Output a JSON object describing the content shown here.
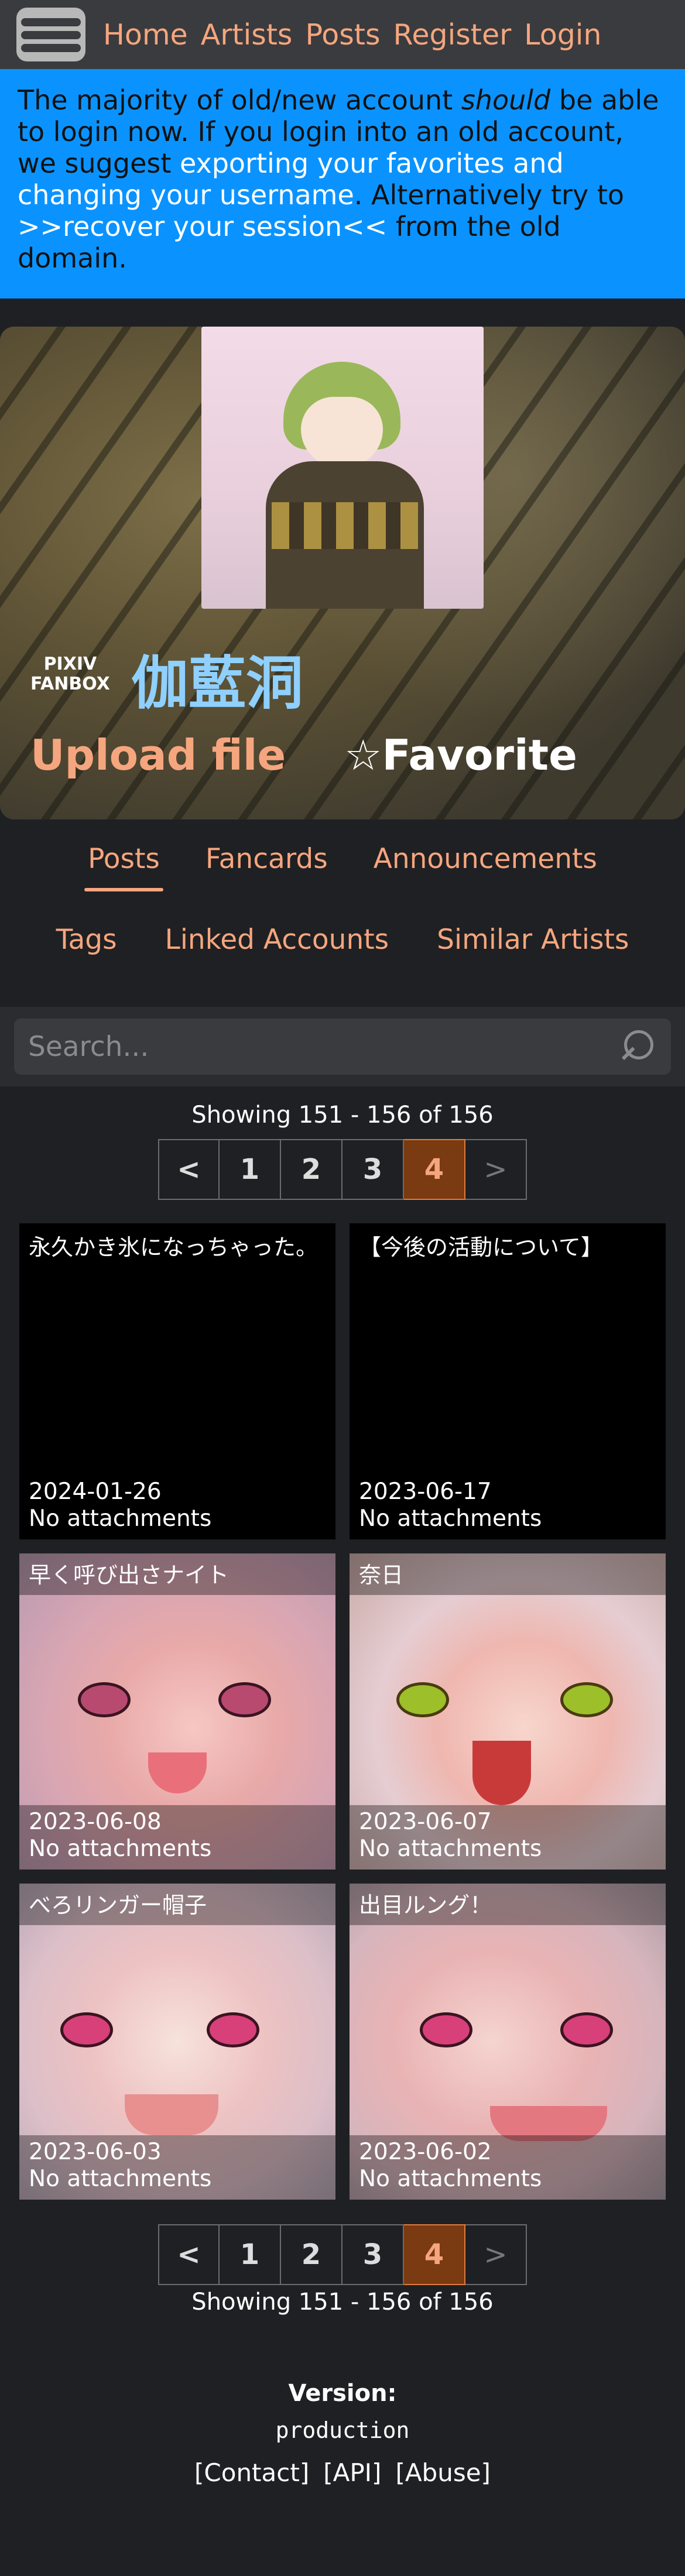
{
  "nav": {
    "links": [
      "Home",
      "Artists",
      "Posts",
      "Register",
      "Login"
    ]
  },
  "announcement": {
    "p1": "The majority of old/new account ",
    "p2": "should",
    "p3": " be able to login now. If you login into an old account, we suggest ",
    "link1": "exporting your favorites and changing your username",
    "p4": ". Alternatively try to ",
    "link2": ">>recover your session<<",
    "p5": " from the old domain."
  },
  "artist": {
    "service_line1": "PIXIV",
    "service_line2": "FANBOX",
    "name": "伽藍洞",
    "upload_label": "Upload file",
    "favorite_star": "☆",
    "favorite_label": "Favorite"
  },
  "tabs": {
    "row1": [
      "Posts",
      "Fancards",
      "Announcements"
    ],
    "row2": [
      "Tags",
      "Linked Accounts",
      "Similar Artists"
    ]
  },
  "search": {
    "placeholder": "Search..."
  },
  "paging": {
    "showing": "Showing 151 - 156 of 156",
    "prev": "<",
    "pages": [
      "1",
      "2",
      "3",
      "4"
    ],
    "current": "4",
    "next": ">"
  },
  "posts": [
    {
      "title": "永久かき氷になっちゃった。",
      "date": "2024-01-26",
      "attachments": "No attachments",
      "thumb": false
    },
    {
      "title": "【今後の活動について】",
      "date": "2023-06-17",
      "attachments": "No attachments",
      "thumb": false
    },
    {
      "title": "早く呼び出さナイト",
      "date": "2023-06-08",
      "attachments": "No attachments",
      "thumb": true
    },
    {
      "title": "奈日",
      "date": "2023-06-07",
      "attachments": "No attachments",
      "thumb": true
    },
    {
      "title": "べろリンガー帽子",
      "date": "2023-06-03",
      "attachments": "No attachments",
      "thumb": true
    },
    {
      "title": "出目ルング！",
      "date": "2023-06-02",
      "attachments": "No attachments",
      "thumb": true
    }
  ],
  "footer": {
    "version_label": "Version:",
    "version_value": "production",
    "links": [
      "[Contact]",
      "[API]",
      "[Abuse]"
    ]
  }
}
